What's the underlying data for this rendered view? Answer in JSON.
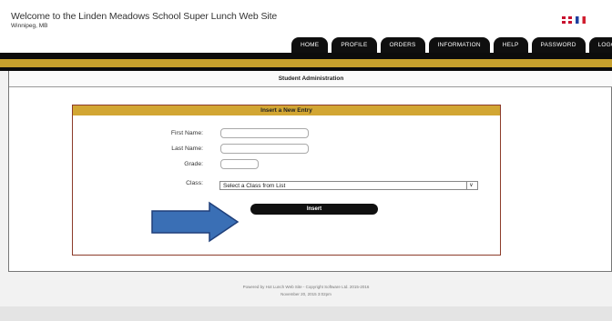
{
  "header": {
    "title": "Welcome to the Linden Meadows School Super Lunch Web Site",
    "city": "Winnipeg, MB"
  },
  "nav": {
    "tabs": [
      "HOME",
      "PROFILE",
      "ORDERS",
      "INFORMATION",
      "HELP",
      "PASSWORD",
      "LOGOUT"
    ]
  },
  "colors": {
    "gold": "#c7a12d",
    "black": "#0c0c0c",
    "form_border": "#8c3b2a",
    "arrow": "#3a6fb5"
  },
  "page": {
    "section_title": "Student Administration"
  },
  "form": {
    "header": "Insert a New Entry",
    "first_name_label": "First Name:",
    "first_name_value": "",
    "last_name_label": "Last Name:",
    "last_name_value": "",
    "grade_label": "Grade:",
    "grade_value": "",
    "class_label": "Class:",
    "class_selected": "Select a Class from List",
    "insert_label": "Insert"
  },
  "footer": {
    "line1": "Powered by Hot Lunch Web Site - Copyright Software Ltd. 2015-2016",
    "line2": "November 20, 2015 3:02pm"
  }
}
